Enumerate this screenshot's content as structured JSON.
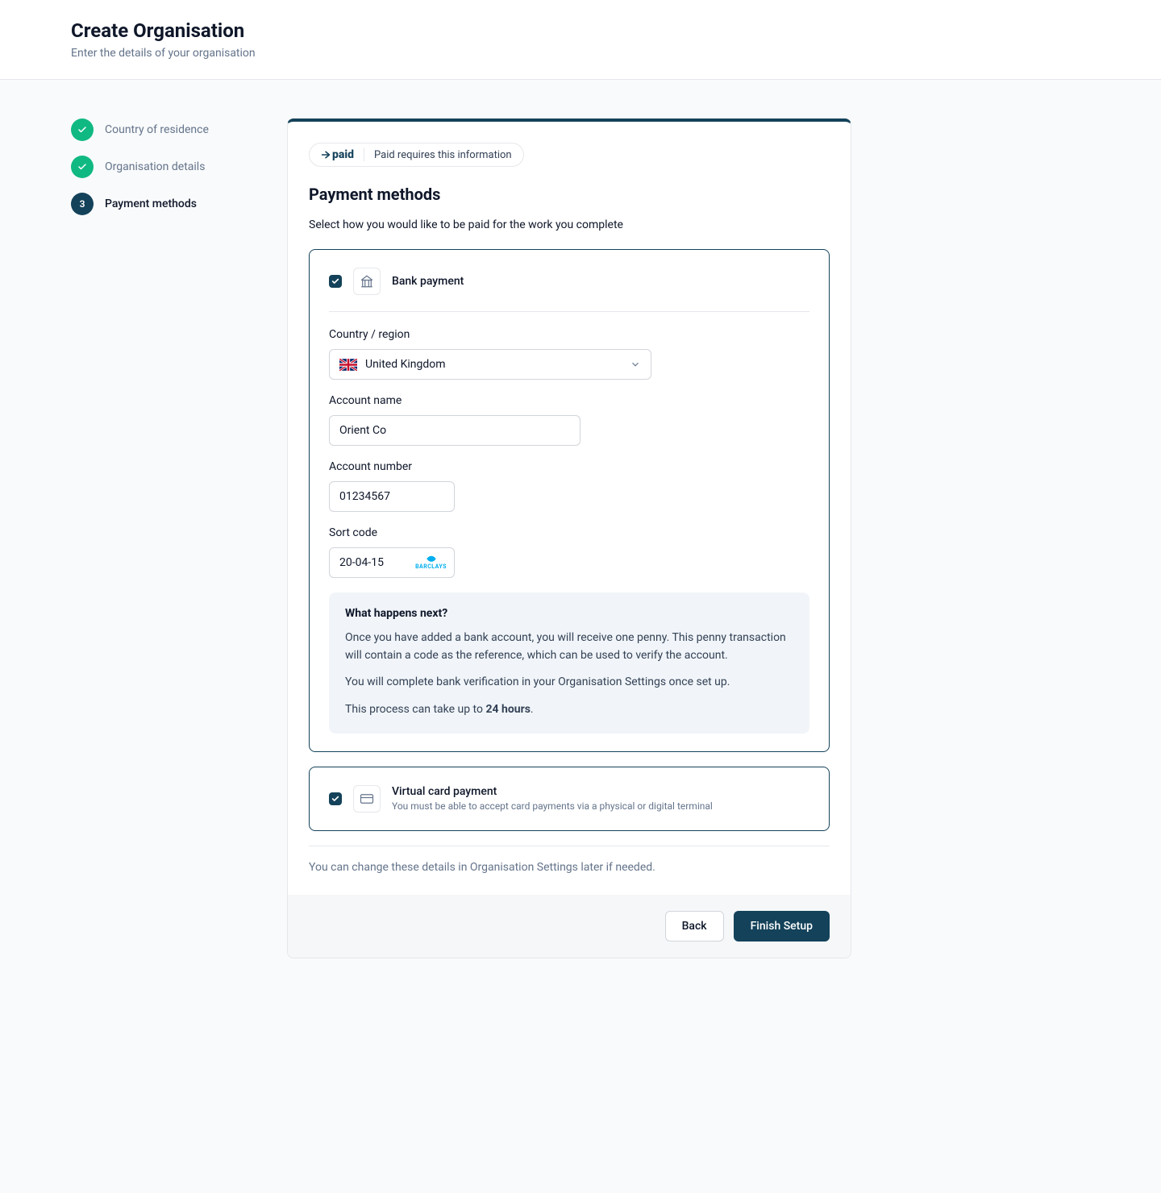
{
  "header": {
    "title": "Create Organisation",
    "subtitle": "Enter the details of your organisation"
  },
  "stepper": {
    "steps": [
      {
        "label": "Country of residence",
        "state": "done"
      },
      {
        "label": "Organisation details",
        "state": "done"
      },
      {
        "label": "Payment methods",
        "state": "current",
        "num": "3"
      }
    ]
  },
  "pill": {
    "brand": "paid",
    "text": "Paid requires this information"
  },
  "section": {
    "title": "Payment methods",
    "desc": "Select how you would like to be paid for the work you complete"
  },
  "bank": {
    "title": "Bank payment",
    "country_label": "Country / region",
    "country_value": "United Kingdom",
    "account_name_label": "Account name",
    "account_name_value": "Orient Co",
    "account_number_label": "Account number",
    "account_number_value": "01234567",
    "sort_code_label": "Sort code",
    "sort_code_value": "20-04-15",
    "sort_bank": "BARCLAYS"
  },
  "info": {
    "heading": "What happens next?",
    "p1": "Once you have added a bank account, you will receive one penny. This penny transaction will contain a code as the reference, which can be used to verify the account.",
    "p2": "You will complete bank verification in your Organisation Settings once set up.",
    "p3_prefix": "This process can take up to ",
    "p3_bold": "24 hours",
    "p3_suffix": "."
  },
  "virtual": {
    "title": "Virtual card payment",
    "sub": "You must be able to accept card payments via a physical or digital terminal"
  },
  "footnote": "You can change these details in Organisation Settings later if needed.",
  "actions": {
    "back": "Back",
    "finish": "Finish Setup"
  }
}
